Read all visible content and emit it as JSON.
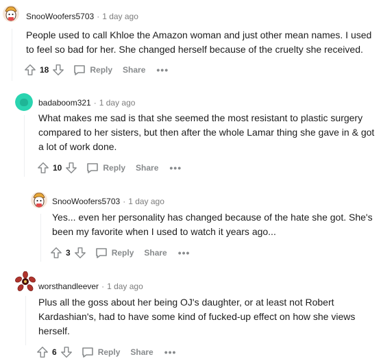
{
  "comments": [
    {
      "author": "SnooWoofers5703",
      "time": "1 day ago",
      "body": "People used to call Khloe the Amazon woman and just other mean names. I used to feel so bad for her. She changed herself because of the cruelty she received.",
      "score": "18",
      "reply_label": "Reply",
      "share_label": "Share",
      "more_label": "•••"
    },
    {
      "author": "badaboom321",
      "time": "1 day ago",
      "body": "What makes me sad is that she seemed the most resistant to plastic surgery compared to her sisters, but then after the whole Lamar thing she gave in & got a lot of work done.",
      "score": "10",
      "reply_label": "Reply",
      "share_label": "Share",
      "more_label": "•••"
    },
    {
      "author": "SnooWoofers5703",
      "time": "1 day ago",
      "body": "Yes... even her personality has changed because of the hate she got. She's been my favorite when I used to watch it years ago...",
      "score": "3",
      "reply_label": "Reply",
      "share_label": "Share",
      "more_label": "•••"
    },
    {
      "author": "worsthandleever",
      "time": "1 day ago",
      "body": "Plus all the goss about her being OJ's daughter, or at least not Robert Kardashian's, had to have some kind of fucked-up effect on how she views herself.",
      "score": "6",
      "reply_label": "Reply",
      "share_label": "Share",
      "more_label": "•••"
    }
  ],
  "separator": "·",
  "colors": {
    "text": "#1c1c1c",
    "meta": "#7c7c7c",
    "action": "#878a8c",
    "thread_line": "#edeff1",
    "avatar_teal": "#2ad4b0"
  }
}
